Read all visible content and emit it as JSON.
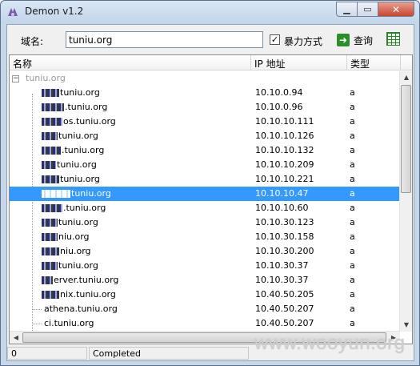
{
  "window": {
    "title": "Demon v1.2",
    "close_icon": "close-icon",
    "maximize_icon": "maximize-icon",
    "minimize_icon": "minimize-icon"
  },
  "toolbar": {
    "domain_label": "域名:",
    "domain_value": "tuniu.org",
    "bruteforce_label": "暴力方式",
    "bruteforce_checked": true,
    "query_label": "查询",
    "query_icon": "arrow-right-icon",
    "export_icon": "spreadsheet-icon"
  },
  "list": {
    "columns": [
      "名称",
      "IP 地址",
      "类型"
    ],
    "root_name": "tuniu.org",
    "rows": [
      {
        "name": "tuniu.org",
        "ip": "10.10.0.94",
        "type": "a",
        "masked": true
      },
      {
        "name": ".tuniu.org",
        "ip": "10.10.0.96",
        "type": "a",
        "masked": true
      },
      {
        "name": "os.tuniu.org",
        "ip": "10.10.10.111",
        "type": "a",
        "masked": true
      },
      {
        "name": "tuniu.org",
        "ip": "10.10.10.126",
        "type": "a",
        "masked": true
      },
      {
        "name": ".tuniu.org",
        "ip": "10.10.10.132",
        "type": "a",
        "masked": true
      },
      {
        "name": "tuniu.org",
        "ip": "10.10.10.209",
        "type": "a",
        "masked": true
      },
      {
        "name": "tuniu.org",
        "ip": "10.10.10.221",
        "type": "a",
        "masked": true
      },
      {
        "name": "tuniu.org",
        "ip": "10.10.10.47",
        "type": "a",
        "masked": true,
        "selected": true
      },
      {
        "name": ".tuniu.org",
        "ip": "10.10.10.60",
        "type": "a",
        "masked": true
      },
      {
        "name": "tuniu.org",
        "ip": "10.10.30.123",
        "type": "a",
        "masked": true
      },
      {
        "name": "niu.org",
        "ip": "10.10.30.158",
        "type": "a",
        "masked": true
      },
      {
        "name": "niu.org",
        "ip": "10.10.30.200",
        "type": "a",
        "masked": true
      },
      {
        "name": "tuniu.org",
        "ip": "10.10.30.37",
        "type": "a",
        "masked": true
      },
      {
        "name": "erver.tuniu.org",
        "ip": "10.10.30.37",
        "type": "a",
        "masked": true
      },
      {
        "name": "nix.tuniu.org",
        "ip": "10.40.50.205",
        "type": "a",
        "masked": true
      },
      {
        "name": "athena.tuniu.org",
        "ip": "10.40.50.207",
        "type": "a",
        "masked": false
      },
      {
        "name": "ci.tuniu.org",
        "ip": "10.40.50.207",
        "type": "a",
        "masked": false
      }
    ]
  },
  "statusbar": {
    "count": "0",
    "status": "Completed"
  },
  "watermark": "www.wooyun.org"
}
